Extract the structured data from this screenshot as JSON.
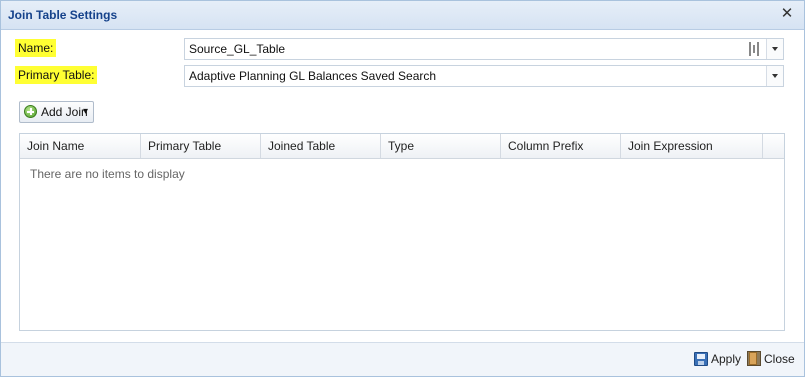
{
  "window": {
    "title": "Join Table Settings",
    "close_glyph": "✕"
  },
  "form": {
    "name_label": "Name:",
    "name_value": "Source_GL_Table",
    "primary_label": "Primary Table:",
    "primary_value": "Adaptive Planning GL Balances Saved Search"
  },
  "toolbar": {
    "add_join_label": "Add Join",
    "add_join_caret": "▾"
  },
  "grid": {
    "columns": [
      "Join Name",
      "Primary Table",
      "Joined Table",
      "Type",
      "Column Prefix",
      "Join Expression"
    ],
    "empty_text": "There are no items to display"
  },
  "footer": {
    "apply_label": "Apply",
    "close_label": "Close"
  },
  "colors": {
    "highlight": "#ffff33",
    "title_text": "#15428b",
    "accent_border": "#a9c2dd"
  },
  "icons": [
    "close-icon",
    "grip-icon",
    "chevron-down-icon",
    "add-icon",
    "save-icon",
    "door-exit-icon"
  ]
}
